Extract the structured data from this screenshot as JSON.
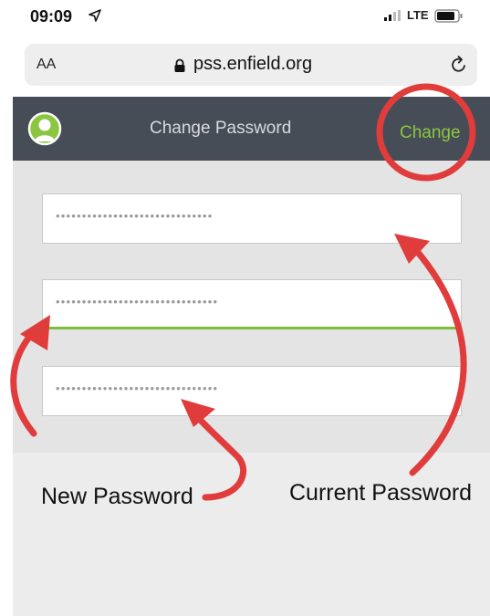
{
  "status_bar": {
    "time": "09:09",
    "network": "LTE"
  },
  "browser": {
    "text_size_label": "AA",
    "url": "pss.enfield.org"
  },
  "header": {
    "title": "Change Password",
    "action_label": "Change",
    "action_color": "#8cc63f",
    "background_color": "#464d56"
  },
  "form": {
    "current_password_value": "••••••••••••••••••••••••••••••",
    "new_password_value": "•••••••••••••••••••••••••••••••",
    "confirm_password_value": "•••••••••••••••••••••••••••••••",
    "focus_color": "#7cbf3c"
  },
  "annotations": {
    "new_password_label": "New Password",
    "current_password_label": "Current Password",
    "arrow_color": "#e03c3c"
  }
}
